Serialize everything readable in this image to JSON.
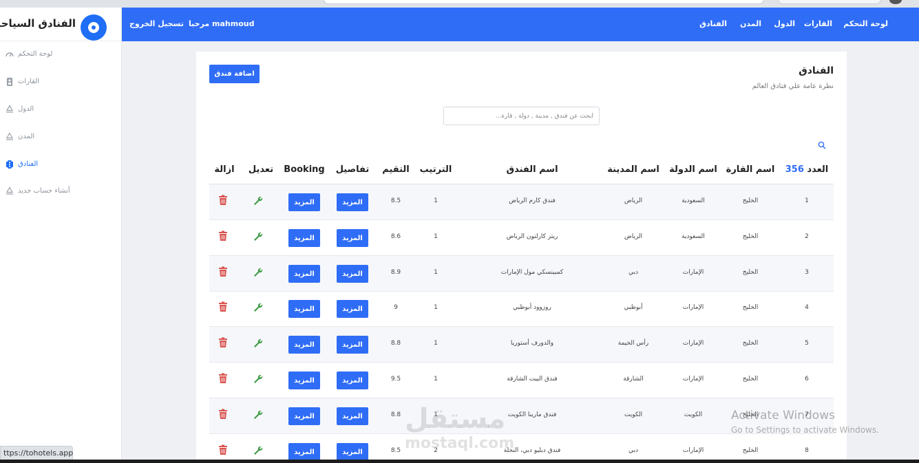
{
  "sidebar": {
    "brand": "الفنادق السياحية",
    "items": [
      {
        "label": "لوحة التحكم",
        "icon": "dashboard-icon"
      },
      {
        "label": "القارات",
        "icon": "continent-icon"
      },
      {
        "label": "الدول",
        "icon": "recycle-icon"
      },
      {
        "label": "المدن",
        "icon": "recycle-icon"
      },
      {
        "label": "الفنادق",
        "icon": "hotel-icon"
      },
      {
        "label": "أنشاء حساب جديد",
        "icon": "recycle-icon"
      }
    ],
    "active_index": 4
  },
  "topbar": {
    "nav": [
      "لوحة التحكم",
      "القارات",
      "الدول",
      "المدن",
      "الفنادق"
    ],
    "greeting": "مرحبا mahmoud",
    "logout": "تسجيل الخروج"
  },
  "page": {
    "title": "الفنادق",
    "subtitle": "نظرة عامة علي فنادق العالم",
    "add_button": "اضافة فندق",
    "search_placeholder": "أبحث عن فندق , مدينة , دولة , قارة..."
  },
  "table": {
    "count_label": "العدد",
    "count_value": "356",
    "headers": {
      "continent": "اسم القارة",
      "country": "اسم الدولة",
      "city": "اسم المدينة",
      "hotel": "اسم الفندق",
      "rank": "الترتيب",
      "rating": "التقيم",
      "details": "تفاصيل",
      "booking": "Booking",
      "edit": "تعديل",
      "remove": "ازالة"
    },
    "more_label": "المزيد",
    "rows": [
      {
        "num": "1",
        "continent": "الخليج",
        "country": "السعودية",
        "city": "الرياض",
        "hotel": "فندق كارم الرياض",
        "rank": "1",
        "rating": "8.5"
      },
      {
        "num": "2",
        "continent": "الخليج",
        "country": "السعودية",
        "city": "الرياض",
        "hotel": "ريتز كارلتون الرياض",
        "rank": "1",
        "rating": "8.6"
      },
      {
        "num": "3",
        "continent": "الخليج",
        "country": "الإمارات",
        "city": "دبي",
        "hotel": "كمبينسكي مول الإمارات",
        "rank": "1",
        "rating": "8.9"
      },
      {
        "num": "4",
        "continent": "الخليج",
        "country": "الإمارات",
        "city": "أبوظبي",
        "hotel": "روزوود أبوظبي",
        "rank": "1",
        "rating": "9"
      },
      {
        "num": "5",
        "continent": "الخليج",
        "country": "الإمارات",
        "city": "رأس الخيمة",
        "hotel": "والدورف أستوريا",
        "rank": "1",
        "rating": "8.8"
      },
      {
        "num": "6",
        "continent": "الخليج",
        "country": "الإمارات",
        "city": "الشارقة",
        "hotel": "فندق البيت الشارقة",
        "rank": "1",
        "rating": "9.5"
      },
      {
        "num": "7",
        "continent": "الخليج",
        "country": "الكويت",
        "city": "الكويت",
        "hotel": "فندق مارينا الكويت",
        "rank": "1",
        "rating": "8.8"
      },
      {
        "num": "8",
        "continent": "الخليج",
        "country": "الإمارات",
        "city": "دبي",
        "hotel": "فندق دبليو دبي، النخلة",
        "rank": "2",
        "rating": "8.5"
      }
    ]
  },
  "overlay": {
    "status_url": "ttps://tohotels.app",
    "watermark_logo": "مستقل",
    "watermark_url": "mostaql.com",
    "activate_title": "Activate Windows",
    "activate_sub": "Go to Settings to activate Windows."
  },
  "colors": {
    "primary": "#2f6df6",
    "danger": "#d9534f",
    "success": "#3f9b45"
  }
}
